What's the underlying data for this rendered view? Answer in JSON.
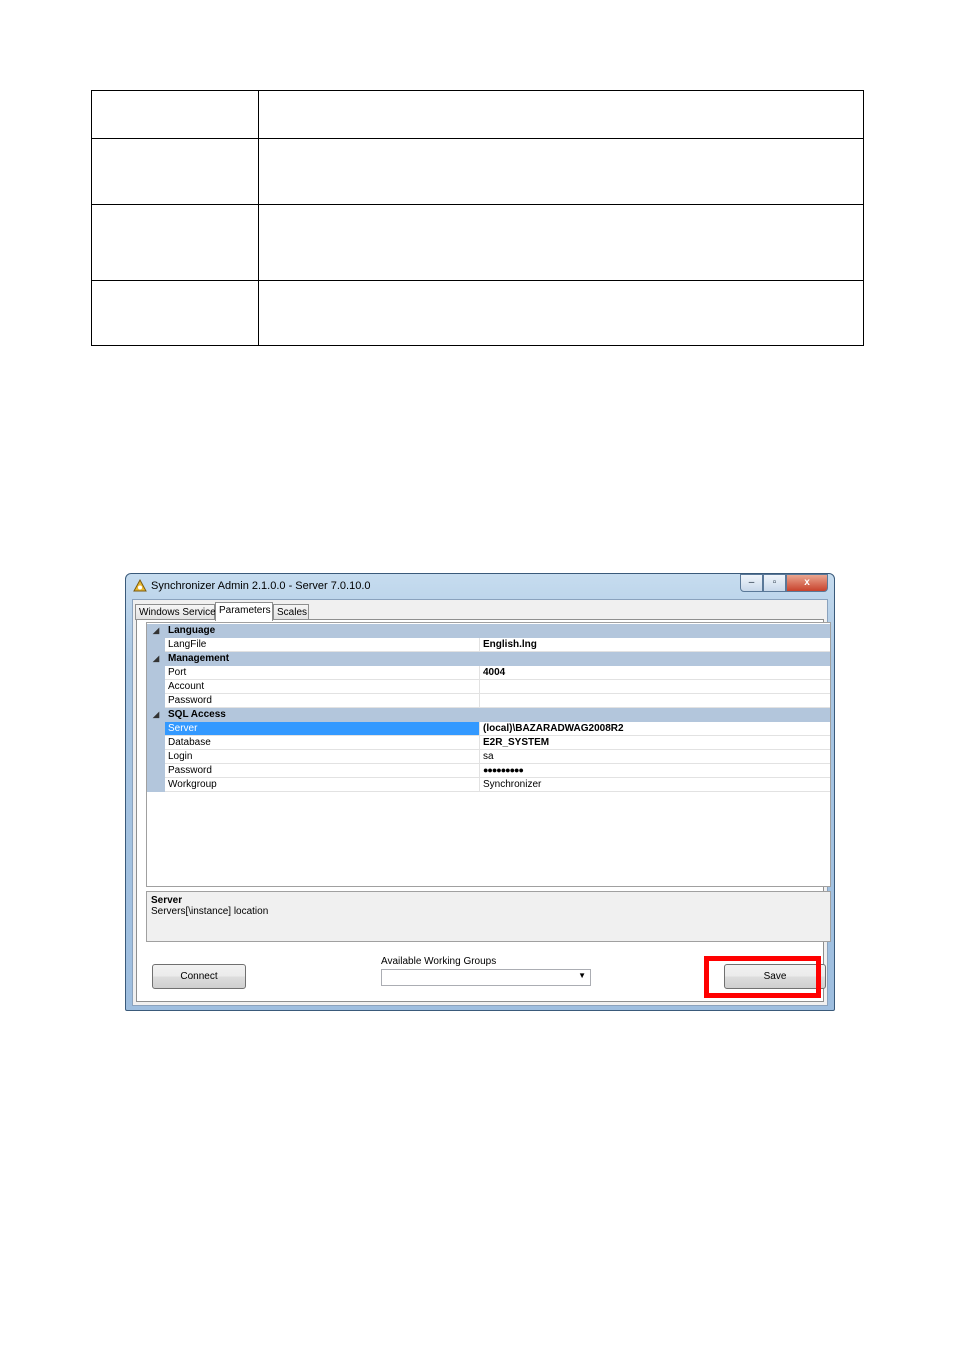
{
  "window": {
    "title": "Synchronizer Admin 2.1.0.0 - Server 7.0.10.0",
    "controls": {
      "minimize": "–",
      "maximize": "▫",
      "close": "x"
    }
  },
  "tabs": [
    "Windows Service",
    "Parameters",
    "Scales"
  ],
  "active_tab": "Parameters",
  "property_grid": {
    "categories": {
      "language": "Language",
      "management": "Management",
      "sql_access": "SQL Access"
    },
    "rows": {
      "langfile": {
        "name": "LangFile",
        "value": "English.lng"
      },
      "port": {
        "name": "Port",
        "value": "4004"
      },
      "account": {
        "name": "Account",
        "value": ""
      },
      "mgmt_password": {
        "name": "Password",
        "value": ""
      },
      "server": {
        "name": "Server",
        "value": "(local)\\BAZARADWAG2008R2"
      },
      "database": {
        "name": "Database",
        "value": "E2R_SYSTEM"
      },
      "login": {
        "name": "Login",
        "value": "sa"
      },
      "sql_password": {
        "name": "Password",
        "value": "●●●●●●●●●"
      },
      "workgroup": {
        "name": "Workgroup",
        "value": "Synchronizer"
      }
    },
    "selected": "Server"
  },
  "help": {
    "title": "Server",
    "description": "Servers[\\instance] location"
  },
  "buttons": {
    "connect": "Connect",
    "save": "Save"
  },
  "working_groups": {
    "label": "Available Working Groups",
    "selected": ""
  },
  "colors": {
    "category_background": "#b3c6dc",
    "selection": "#3399ff",
    "highlight_box": "#ff0000"
  }
}
